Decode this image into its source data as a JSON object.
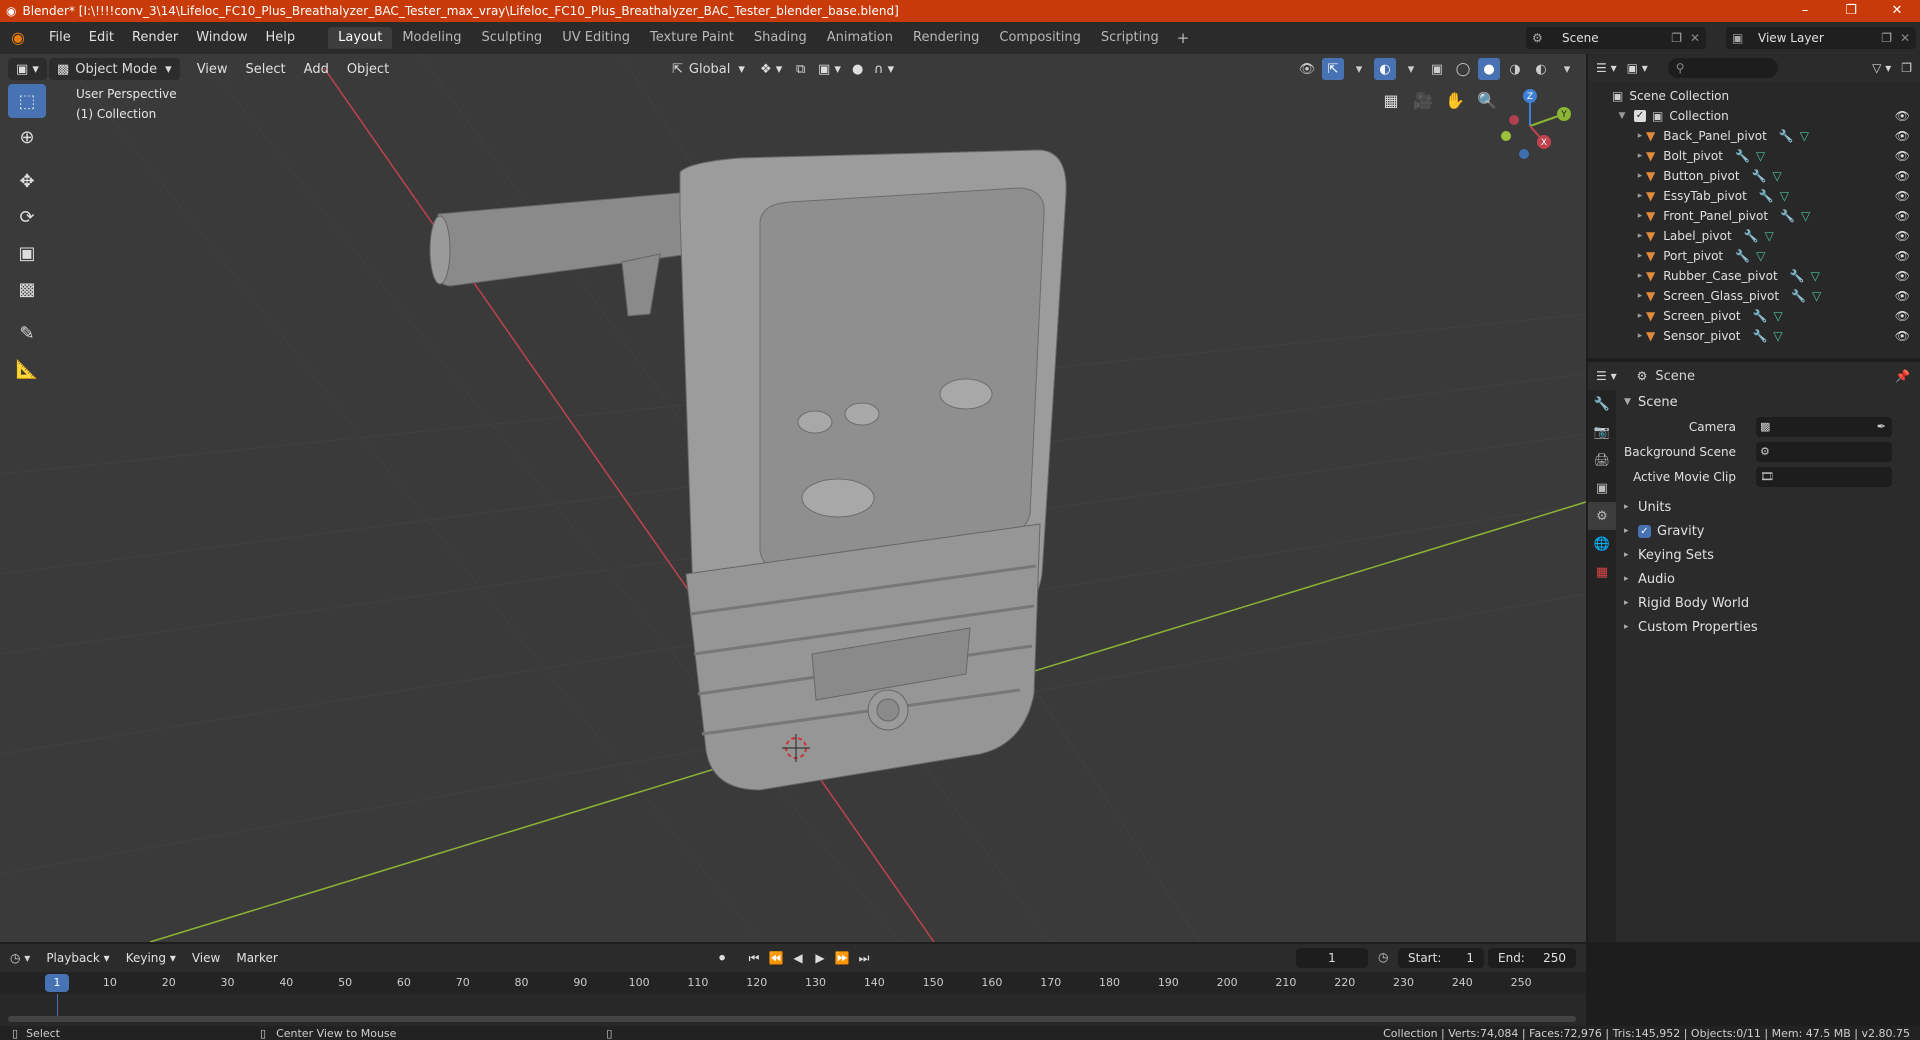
{
  "window": {
    "title": "Blender* [I:\\!!!!conv_3\\14\\Lifeloc_FC10_Plus_Breathalyzer_BAC_Tester_max_vray\\Lifeloc_FC10_Plus_Breathalyzer_BAC_Tester_blender_base.blend]",
    "minimize": "–",
    "maximize": "❐",
    "close": "✕"
  },
  "menubar": {
    "items": [
      "File",
      "Edit",
      "Render",
      "Window",
      "Help"
    ],
    "workspaces": [
      "Layout",
      "Modeling",
      "Sculpting",
      "UV Editing",
      "Texture Paint",
      "Shading",
      "Animation",
      "Rendering",
      "Compositing",
      "Scripting"
    ],
    "active_workspace": "Layout",
    "add_tab": "+",
    "scene": "Scene",
    "view_layer": "View Layer"
  },
  "viewport": {
    "mode": "Object Mode",
    "menus": [
      "View",
      "Select",
      "Add",
      "Object"
    ],
    "transform_orientation": "Global",
    "perspective_label": "User Perspective",
    "collection_label": "(1) Collection",
    "gizmo_axes": {
      "x": "X",
      "y": "Y",
      "z": "Z"
    },
    "colors": {
      "x_axis": "#c0424f",
      "y_axis": "#8bb533",
      "z_axis": "#3f7fd6",
      "grid": "#444444",
      "background": "#3a3a3a"
    }
  },
  "outliner": {
    "search_placeholder": "",
    "scene_collection": "Scene Collection",
    "collection": "Collection",
    "objects": [
      "Back_Panel_pivot",
      "Bolt_pivot",
      "Button_pivot",
      "EssyTab_pivot",
      "Front_Panel_pivot",
      "Label_pivot",
      "Port_pivot",
      "Rubber_Case_pivot",
      "Screen_Glass_pivot",
      "Screen_pivot",
      "Sensor_pivot"
    ]
  },
  "properties": {
    "header": "Scene",
    "section": "Scene",
    "camera_label": "Camera",
    "background_scene_label": "Background Scene",
    "active_movie_clip_label": "Active Movie Clip",
    "panels": [
      "Units",
      "Gravity",
      "Keying Sets",
      "Audio",
      "Rigid Body World",
      "Custom Properties"
    ],
    "gravity_checked": true
  },
  "timeline": {
    "menus": [
      "Playback",
      "Keying",
      "View",
      "Marker"
    ],
    "current_frame": "1",
    "start_label": "Start:",
    "start": "1",
    "end_label": "End:",
    "end": "250",
    "ticks": [
      "10",
      "20",
      "30",
      "40",
      "50",
      "60",
      "70",
      "80",
      "90",
      "100",
      "110",
      "120",
      "130",
      "140",
      "150",
      "160",
      "170",
      "180",
      "190",
      "200",
      "210",
      "220",
      "230",
      "240",
      "250"
    ]
  },
  "statusbar": {
    "left": "Select",
    "middle": "Center View to Mouse",
    "right": "Collection | Verts:74,084 | Faces:72,976 | Tris:145,952 | Objects:0/11 | Mem: 47.5 MB | v2.80.75"
  }
}
